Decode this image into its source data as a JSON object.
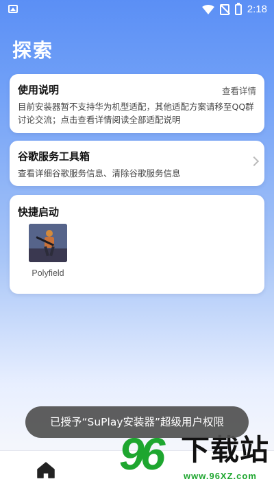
{
  "status_bar": {
    "time": "2:18",
    "icons": [
      "image-icon",
      "wifi-icon",
      "no-sim-icon",
      "battery-charging-icon"
    ]
  },
  "page": {
    "title": "探索"
  },
  "usage_card": {
    "title": "使用说明",
    "link_label": "查看详情",
    "description": "目前安装器暂不支持华为机型适配，其他适配方案请移至QQ群讨论交流；点击查看详情阅读全部适配说明"
  },
  "google_card": {
    "title": "谷歌服务工具箱",
    "description": "查看详细谷歌服务信息、清除谷歌服务信息",
    "icon": "chevron-right-icon"
  },
  "quick_launch": {
    "title": "快捷启动",
    "apps": [
      {
        "label": "Polyfield",
        "icon": "polyfield-app-icon"
      }
    ]
  },
  "toast": {
    "message": "已授予“SuPlay安装器”超级用户权限"
  },
  "bottom_nav": {
    "items": [
      {
        "icon": "home-icon"
      }
    ]
  },
  "watermark": {
    "number": "96",
    "text": "下载站",
    "url": "www.96XZ.com"
  },
  "colors": {
    "accent": "#5b8ff5",
    "watermark_green": "#1ea62f"
  }
}
